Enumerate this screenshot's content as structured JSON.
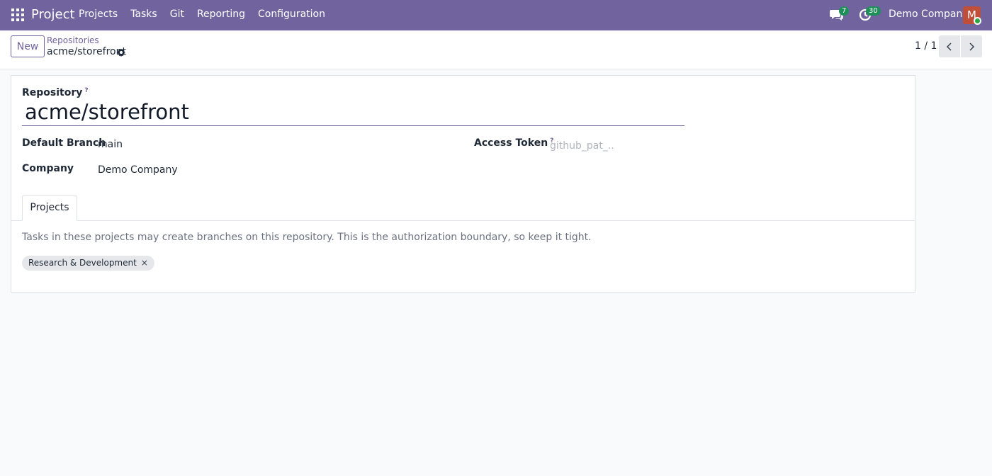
{
  "navbar": {
    "app_name": "Project",
    "menu": [
      "Projects",
      "Tasks",
      "Git",
      "Reporting",
      "Configuration"
    ],
    "messages_count": "7",
    "activities_count": "30",
    "company": "Demo Company",
    "avatar_initial": "M",
    "icons": {
      "apps": "apps-grid-icon",
      "messages": "chat-icon",
      "activities": "clock-icon"
    },
    "colors": {
      "navbar": "#71639e",
      "badge": "#1f8f5a",
      "avatar": "#c04f3a"
    }
  },
  "control_panel": {
    "new_label": "New",
    "breadcrumb_parent": "Repositories",
    "breadcrumb_current": "acme/storefront",
    "pager": "1 / 1"
  },
  "form": {
    "repository_label": "Repository",
    "repository_help": "?",
    "repository_value": "acme/storefront",
    "default_branch_label": "Default Branch",
    "default_branch_value": "main",
    "company_label": "Company",
    "company_value": "Demo Company",
    "access_token_label": "Access Token",
    "access_token_help": "?",
    "access_token_placeholder": "github_pat_...",
    "tabs": [
      "Projects"
    ],
    "projects_description": "Tasks in these projects may create branches on this repository. This is the authorization boundary, so keep it tight.",
    "projects_tags": [
      "Research & Development"
    ],
    "tag_remove": "×"
  }
}
